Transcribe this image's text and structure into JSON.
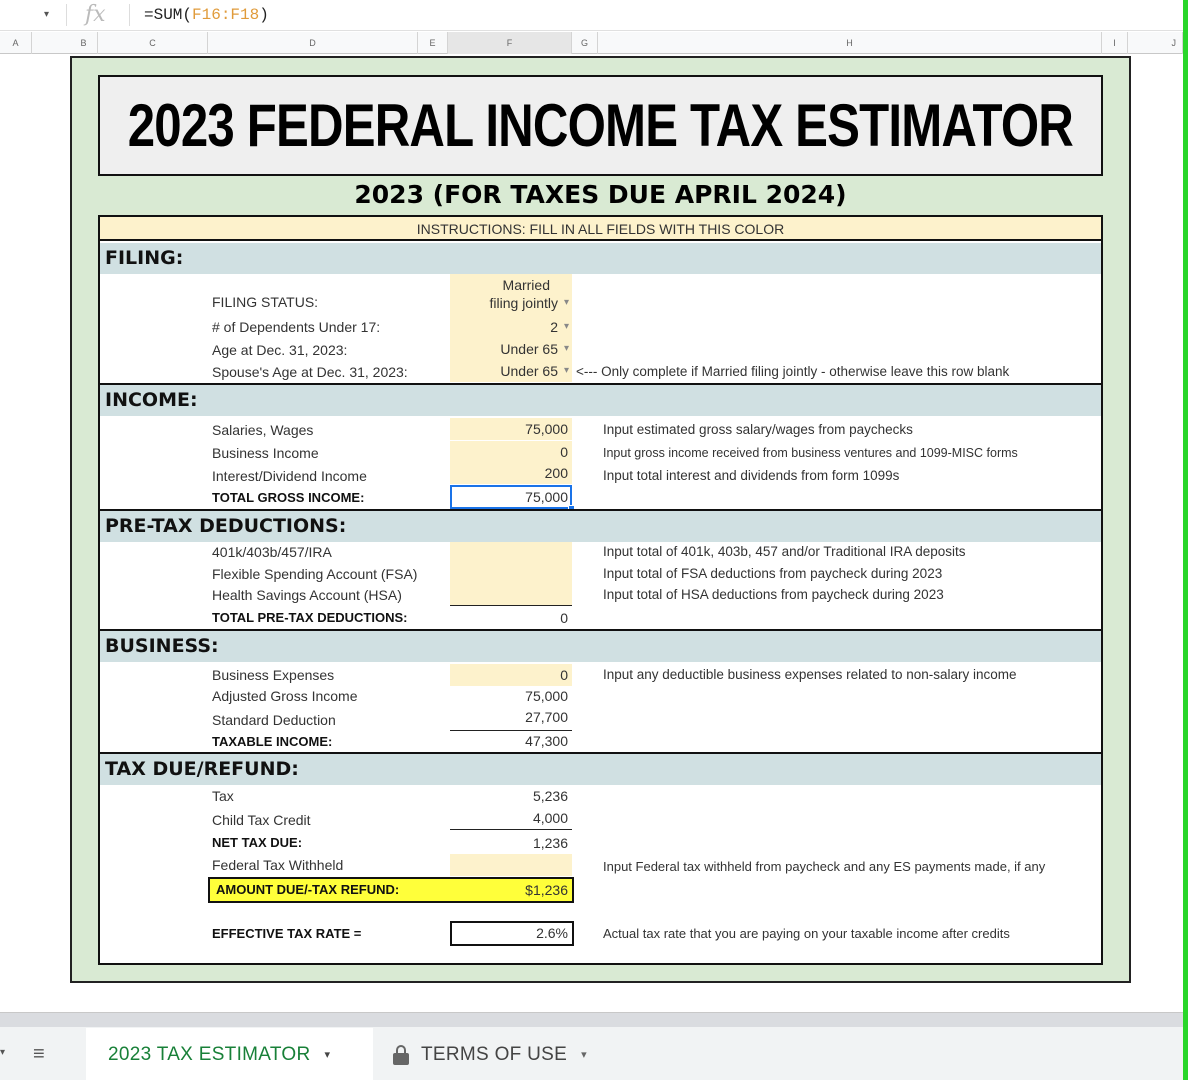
{
  "formula_bar": {
    "name_box_caret": "▾",
    "fx_label": "fx",
    "formula_prefix": "=SUM(",
    "formula_ref": "F16:F18",
    "formula_suffix": ")"
  },
  "columns": [
    "A",
    "B",
    "C",
    "D",
    "E",
    "F",
    "G",
    "H",
    "I",
    "J"
  ],
  "active_column": "F",
  "sheet": {
    "title": "2023 FEDERAL INCOME TAX ESTIMATOR",
    "subtitle": "2023 (FOR TAXES DUE APRIL 2024)",
    "instructions": "INSTRUCTIONS: FILL IN ALL FIELDS WITH THIS COLOR",
    "input_color": "#fdf2cc",
    "frame_color": "#d9ead3",
    "section_color": "#d0e0e2",
    "highlight_color": "#ffff3a",
    "filing": {
      "heading": "FILING:",
      "status_label": "FILING STATUS:",
      "status_value_line1": "Married",
      "status_value_line2": "filing jointly",
      "dependents_label": "# of Dependents Under 17:",
      "dependents_value": "2",
      "age_label": "Age at Dec. 31, 2023:",
      "age_value": "Under 65",
      "spouse_age_label": "Spouse's Age at Dec. 31, 2023:",
      "spouse_age_value": "Under 65",
      "spouse_hint": "<--- Only complete if Married filing jointly - otherwise leave this row blank"
    },
    "income": {
      "heading": "INCOME:",
      "salaries_label": "Salaries, Wages",
      "salaries_value": "75,000",
      "salaries_hint": "Input estimated gross salary/wages from paychecks",
      "business_label": "Business Income",
      "business_value": "0",
      "business_hint": "Input gross income received from business ventures and 1099-MISC forms",
      "interest_label": "Interest/Dividend Income",
      "interest_value": "200",
      "interest_hint": "Input total interest and dividends from form 1099s",
      "total_label": "TOTAL GROSS INCOME:",
      "total_value": "75,000"
    },
    "pretax": {
      "heading": "PRE-TAX DEDUCTIONS:",
      "retirement_label": "401k/403b/457/IRA",
      "retirement_value": "",
      "retirement_hint": "Input total of 401k, 403b, 457 and/or Traditional IRA deposits",
      "fsa_label": "Flexible Spending Account (FSA)",
      "fsa_value": "",
      "fsa_hint": "Input total of FSA deductions from paycheck during 2023",
      "hsa_label": "Health Savings Account (HSA)",
      "hsa_value": "",
      "hsa_hint": "Input total of HSA deductions from paycheck during 2023",
      "total_label": "TOTAL PRE-TAX DEDUCTIONS:",
      "total_value": "0"
    },
    "business": {
      "heading": "BUSINESS:",
      "expenses_label": "Business Expenses",
      "expenses_value": "0",
      "expenses_hint": "Input any deductible business expenses related to non-salary income",
      "agi_label": "Adjusted Gross Income",
      "agi_value": "75,000",
      "std_label": "Standard Deduction",
      "std_value": "27,700",
      "taxable_label": "TAXABLE INCOME:",
      "taxable_value": "47,300"
    },
    "tax": {
      "heading": "TAX DUE/REFUND:",
      "tax_label": "Tax",
      "tax_value": "5,236",
      "ctc_label": "Child Tax Credit",
      "ctc_value": "4,000",
      "net_label": "NET TAX DUE:",
      "net_value": "1,236",
      "withheld_label": "Federal Tax Withheld",
      "withheld_value": "",
      "withheld_hint": "Input Federal tax withheld from paycheck and any ES payments made, if any",
      "amount_label": "AMOUNT DUE/-TAX REFUND:",
      "amount_value": "$1,236",
      "rate_label": "EFFECTIVE TAX RATE =",
      "rate_value": "2.6%",
      "rate_hint": "Actual tax rate that you are paying on your taxable income after credits"
    }
  },
  "tabs": {
    "all_sheets_icon": "≡",
    "items": [
      {
        "label": "2023 TAX ESTIMATOR",
        "active": true
      },
      {
        "label": "TERMS OF USE",
        "active": false,
        "locked": true
      }
    ],
    "caret": "▾",
    "left_caret": "▾"
  }
}
